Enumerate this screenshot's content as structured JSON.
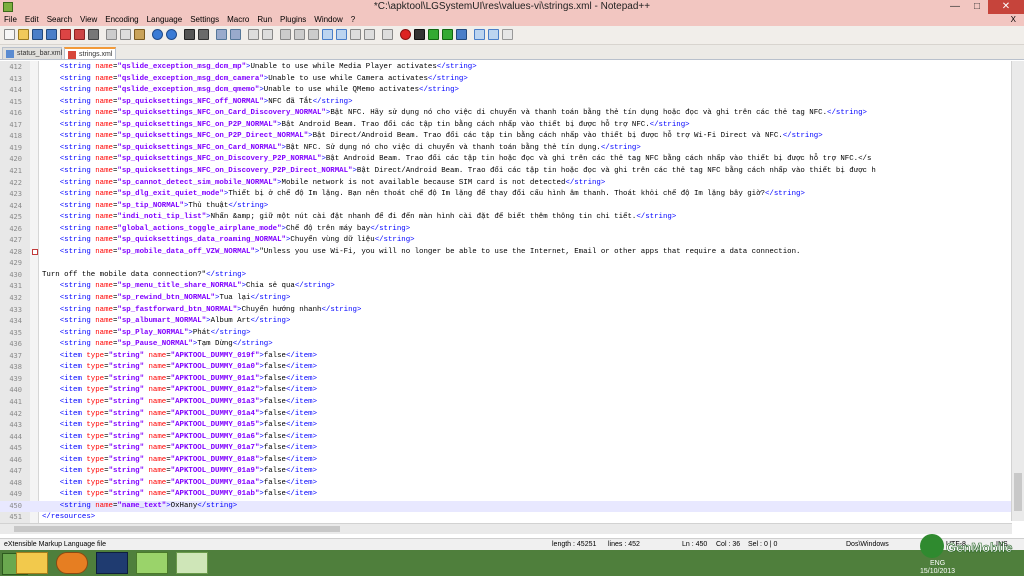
{
  "window": {
    "title": "*C:\\apktool\\LGSystemUI\\res\\values-vi\\strings.xml - Notepad++"
  },
  "menu": [
    "File",
    "Edit",
    "Search",
    "View",
    "Encoding",
    "Language",
    "Settings",
    "Macro",
    "Run",
    "Plugins",
    "Window",
    "?"
  ],
  "menu_close": "X",
  "tabs": [
    {
      "label": "status_bar.xml",
      "active": false
    },
    {
      "label": "strings.xml",
      "active": true
    }
  ],
  "lines": [
    {
      "n": "412",
      "text": "    <string name=\"qslide_exception_msg_dcm_mp\">Unable to use while Media Player activates</string>"
    },
    {
      "n": "413",
      "text": "    <string name=\"qslide_exception_msg_dcm_camera\">Unable to use while Camera activates</string>"
    },
    {
      "n": "414",
      "text": "    <string name=\"qslide_exception_msg_dcm_qmemo\">Unable to use while QMemo activates</string>"
    },
    {
      "n": "415",
      "text": "    <string name=\"sp_quicksettings_NFC_off_NORMAL\">NFC đã Tắt</string>"
    },
    {
      "n": "416",
      "text": "    <string name=\"sp_quicksettings_NFC_on_Card_Discovery_NORMAL\">Bật NFC. Hãy sử dụng nó cho việc di chuyển và thanh toán bằng thẻ tín dụng hoặc đọc và ghi trên các thẻ tag NFC.</string>"
    },
    {
      "n": "417",
      "text": "    <string name=\"sp_quicksettings_NFC_on_P2P_NORMAL\">Bật Android Beam. Trao đổi các tập tin bằng cách nhấp vào thiết bị được hỗ trợ NFC.</string>"
    },
    {
      "n": "418",
      "text": "    <string name=\"sp_quicksettings_NFC_on_P2P_Direct_NORMAL\">Bật Direct/Android Beam. Trao đổi các tập tin bằng cách nhấp vào thiết bị được hỗ trợ Wi-Fi Direct và NFC.</string>"
    },
    {
      "n": "419",
      "text": "    <string name=\"sp_quicksettings_NFC_on_Card_NORMAL\">Bật NFC. Sử dụng nó cho việc di chuyển và thanh toán bằng thẻ tín dụng.</string>"
    },
    {
      "n": "420",
      "text": "    <string name=\"sp_quicksettings_NFC_on_Discovery_P2P_NORMAL\">Bật Android Beam. Trao đổi các tập tin hoặc đọc và ghi trên các thẻ tag NFC bằng cách nhấp vào thiết bị được hỗ trợ NFC.</s"
    },
    {
      "n": "421",
      "text": "    <string name=\"sp_quicksettings_NFC_on_Discovery_P2P_Direct_NORMAL\">Bật Direct/Android Beam. Trao đổi các tập tin hoặc đọc và ghi trên các thẻ tag NFC bằng cách nhấp vào thiết bị được h"
    },
    {
      "n": "422",
      "text": "    <string name=\"sp_cannot_detect_sim_mobile_NORMAL\">Mobile network is not available because SIM card is not detected</string>"
    },
    {
      "n": "423",
      "text": "    <string name=\"sp_dlg_exit_quiet_mode\">Thiết bị ở chế độ Im lặng. Bạn nên thoát chế độ Im lặng để thay đổi cấu hình âm thanh. Thoát khỏi chế độ Im lặng bây giờ?</string>"
    },
    {
      "n": "424",
      "text": "    <string name=\"sp_tip_NORMAL\">Thủ thuật</string>"
    },
    {
      "n": "425",
      "text": "    <string name=\"indi_noti_tip_list\">Nhấn &amp; giữ một nút cài đặt nhanh để đi đến màn hình cài đặt để biết thêm thông tin chi tiết.</string>"
    },
    {
      "n": "426",
      "text": "    <string name=\"global_actions_toggle_airplane_mode\">Chế độ trên máy bay</string>"
    },
    {
      "n": "427",
      "text": "    <string name=\"sp_quicksettings_data_roaming_NORMAL\">Chuyển vùng dữ liệu</string>"
    },
    {
      "n": "428",
      "text": "    <string name=\"sp_mobile_data_off_VZW_NORMAL\">\"Unless you use Wi-Fi, you will no longer be able to use the Internet, Email or other apps that require a data connection."
    },
    {
      "n": "429",
      "text": ""
    },
    {
      "n": "430",
      "text": "Turn off the mobile data connection?\"</string>"
    },
    {
      "n": "431",
      "text": "    <string name=\"sp_menu_title_share_NORMAL\">Chia sẻ qua</string>"
    },
    {
      "n": "432",
      "text": "    <string name=\"sp_rewind_btn_NORMAL\">Tua lại</string>"
    },
    {
      "n": "433",
      "text": "    <string name=\"sp_fastforward_btn_NORMAL\">Chuyển hướng nhanh</string>"
    },
    {
      "n": "434",
      "text": "    <string name=\"sp_albumart_NORMAL\">Album Art</string>"
    },
    {
      "n": "435",
      "text": "    <string name=\"sp_Play_NORMAL\">Phát</string>"
    },
    {
      "n": "436",
      "text": "    <string name=\"sp_Pause_NORMAL\">Tạm Dừng</string>"
    },
    {
      "n": "437",
      "text": "    <item type=\"string\" name=\"APKTOOL_DUMMY_019f\">false</item>"
    },
    {
      "n": "438",
      "text": "    <item type=\"string\" name=\"APKTOOL_DUMMY_01a0\">false</item>"
    },
    {
      "n": "439",
      "text": "    <item type=\"string\" name=\"APKTOOL_DUMMY_01a1\">false</item>"
    },
    {
      "n": "440",
      "text": "    <item type=\"string\" name=\"APKTOOL_DUMMY_01a2\">false</item>"
    },
    {
      "n": "441",
      "text": "    <item type=\"string\" name=\"APKTOOL_DUMMY_01a3\">false</item>"
    },
    {
      "n": "442",
      "text": "    <item type=\"string\" name=\"APKTOOL_DUMMY_01a4\">false</item>"
    },
    {
      "n": "443",
      "text": "    <item type=\"string\" name=\"APKTOOL_DUMMY_01a5\">false</item>"
    },
    {
      "n": "444",
      "text": "    <item type=\"string\" name=\"APKTOOL_DUMMY_01a6\">false</item>"
    },
    {
      "n": "445",
      "text": "    <item type=\"string\" name=\"APKTOOL_DUMMY_01a7\">false</item>"
    },
    {
      "n": "446",
      "text": "    <item type=\"string\" name=\"APKTOOL_DUMMY_01a8\">false</item>"
    },
    {
      "n": "447",
      "text": "    <item type=\"string\" name=\"APKTOOL_DUMMY_01a9\">false</item>"
    },
    {
      "n": "448",
      "text": "    <item type=\"string\" name=\"APKTOOL_DUMMY_01aa\">false</item>"
    },
    {
      "n": "449",
      "text": "    <item type=\"string\" name=\"APKTOOL_DUMMY_01ab\">false</item>"
    },
    {
      "n": "450",
      "text": "    <string name=\"name_text\">OxHany</string>"
    },
    {
      "n": "451",
      "text": "</resources>"
    }
  ],
  "current_line": "450",
  "status": {
    "language": "eXtensible Markup Language file",
    "length": "length : 45251",
    "lines": "lines : 452",
    "position": "Ln : 450",
    "col": "Col : 36",
    "sel": "Sel : 0 | 0",
    "eol": "Dos\\Windows",
    "encoding": "UTF-8",
    "ins": "INS"
  },
  "tray": {
    "time": "ENG",
    "date": "15/10/2013"
  },
  "watermark": "GenMobile",
  "colors": {
    "titlebar": "#f2c6c1",
    "taskbar": "#4f7f3c",
    "current_line": "#e8e8ff",
    "tag": "#0000ff",
    "attr": "#ff0000",
    "attr_value": "#8000ff"
  }
}
